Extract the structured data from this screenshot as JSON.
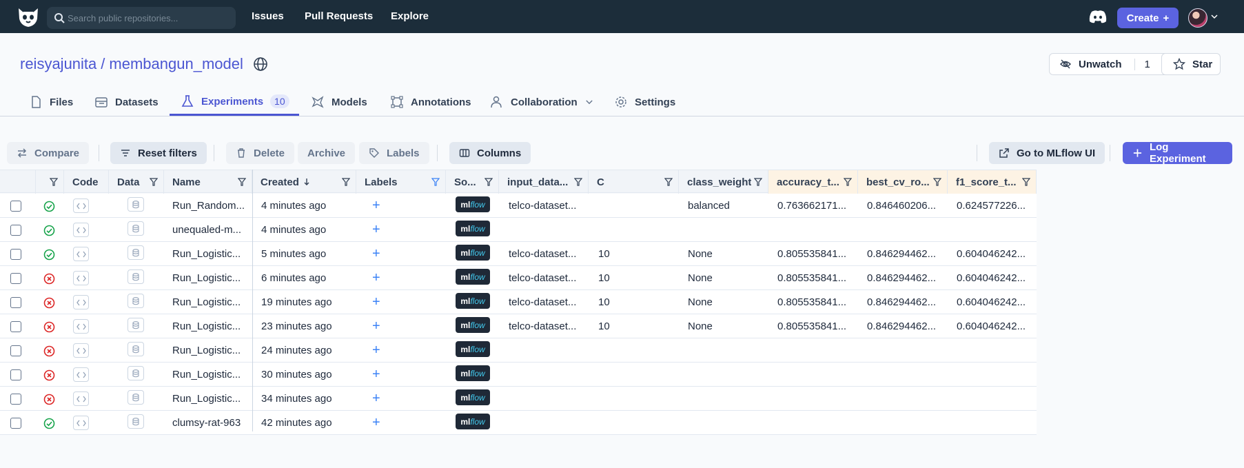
{
  "nav": {
    "search_placeholder": "Search public repositories...",
    "links": [
      "Issues",
      "Pull Requests",
      "Explore"
    ],
    "create_label": "Create"
  },
  "repo": {
    "owner": "reisyajunita",
    "name": "membangun_model",
    "unwatch_label": "Unwatch",
    "watch_count": "1",
    "star_label": "Star"
  },
  "tabs": [
    {
      "label": "Files"
    },
    {
      "label": "Datasets"
    },
    {
      "label": "Experiments",
      "badge": "10"
    },
    {
      "label": "Models"
    },
    {
      "label": "Annotations"
    },
    {
      "label": "Collaboration"
    },
    {
      "label": "Settings"
    }
  ],
  "toolbar": {
    "compare": "Compare",
    "reset_filters": "Reset filters",
    "delete": "Delete",
    "archive": "Archive",
    "labels": "Labels",
    "columns": "Columns",
    "mlflow_ui": "Go to MLflow UI",
    "log_experiment": "Log Experiment"
  },
  "table": {
    "columns": [
      "Code",
      "Data",
      "Name",
      "Created",
      "Labels",
      "So...",
      "input_data...",
      "C",
      "class_weight",
      "accuracy_t...",
      "best_cv_ro...",
      "f1_score_t..."
    ],
    "mlflow_text": [
      "ml",
      "flow"
    ],
    "rows": [
      {
        "status": "success",
        "name": "Run_Random...",
        "created": "4 minutes ago",
        "input": "telco-dataset...",
        "c": "",
        "class_weight": "balanced",
        "accuracy": "0.763662171...",
        "best_cv": "0.846460206...",
        "f1": "0.624577226..."
      },
      {
        "status": "success",
        "name": "unequaled-m...",
        "created": "4 minutes ago",
        "input": "",
        "c": "",
        "class_weight": "",
        "accuracy": "",
        "best_cv": "",
        "f1": ""
      },
      {
        "status": "success",
        "name": "Run_Logistic...",
        "created": "5 minutes ago",
        "input": "telco-dataset...",
        "c": "10",
        "class_weight": "None",
        "accuracy": "0.805535841...",
        "best_cv": "0.846294462...",
        "f1": "0.604046242..."
      },
      {
        "status": "failed",
        "name": "Run_Logistic...",
        "created": "6 minutes ago",
        "input": "telco-dataset...",
        "c": "10",
        "class_weight": "None",
        "accuracy": "0.805535841...",
        "best_cv": "0.846294462...",
        "f1": "0.604046242..."
      },
      {
        "status": "failed",
        "name": "Run_Logistic...",
        "created": "19 minutes ago",
        "input": "telco-dataset...",
        "c": "10",
        "class_weight": "None",
        "accuracy": "0.805535841...",
        "best_cv": "0.846294462...",
        "f1": "0.604046242..."
      },
      {
        "status": "failed",
        "name": "Run_Logistic...",
        "created": "23 minutes ago",
        "input": "telco-dataset...",
        "c": "10",
        "class_weight": "None",
        "accuracy": "0.805535841...",
        "best_cv": "0.846294462...",
        "f1": "0.604046242..."
      },
      {
        "status": "failed",
        "name": "Run_Logistic...",
        "created": "24 minutes ago",
        "input": "",
        "c": "",
        "class_weight": "",
        "accuracy": "",
        "best_cv": "",
        "f1": ""
      },
      {
        "status": "failed",
        "name": "Run_Logistic...",
        "created": "30 minutes ago",
        "input": "",
        "c": "",
        "class_weight": "",
        "accuracy": "",
        "best_cv": "",
        "f1": ""
      },
      {
        "status": "failed",
        "name": "Run_Logistic...",
        "created": "34 minutes ago",
        "input": "",
        "c": "",
        "class_weight": "",
        "accuracy": "",
        "best_cv": "",
        "f1": ""
      },
      {
        "status": "success",
        "name": "clumsy-rat-963",
        "created": "42 minutes ago",
        "input": "",
        "c": "",
        "class_weight": "",
        "accuracy": "",
        "best_cv": "",
        "f1": ""
      }
    ]
  },
  "colors": {
    "accent": "#4b56d2",
    "success": "#16a34a",
    "failed": "#dc2626",
    "nav_bg": "#1c2d3a"
  }
}
